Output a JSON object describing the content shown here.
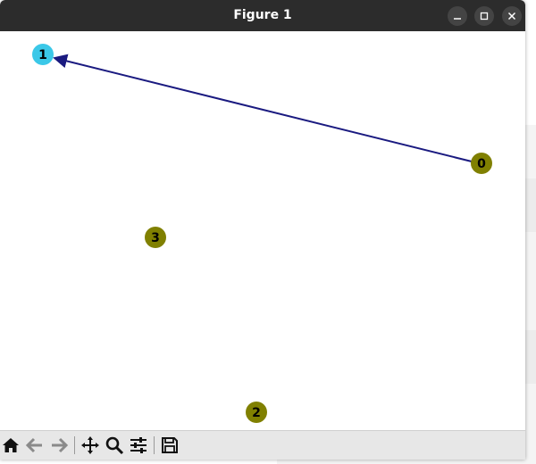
{
  "window": {
    "title": "Figure 1"
  },
  "graph": {
    "nodes": [
      {
        "label": "0",
        "color": "#808000"
      },
      {
        "label": "1",
        "color": "#3bc8e8"
      },
      {
        "label": "2",
        "color": "#808000"
      },
      {
        "label": "3",
        "color": "#808000"
      }
    ],
    "edges": [
      {
        "from": "0",
        "to": "1",
        "color": "#1a1a80"
      }
    ]
  },
  "toolbar": {
    "buttons": [
      "home-icon",
      "back-arrow-icon",
      "forward-arrow-icon",
      "pan-icon",
      "zoom-icon",
      "configure-subplots-icon",
      "save-icon"
    ]
  }
}
